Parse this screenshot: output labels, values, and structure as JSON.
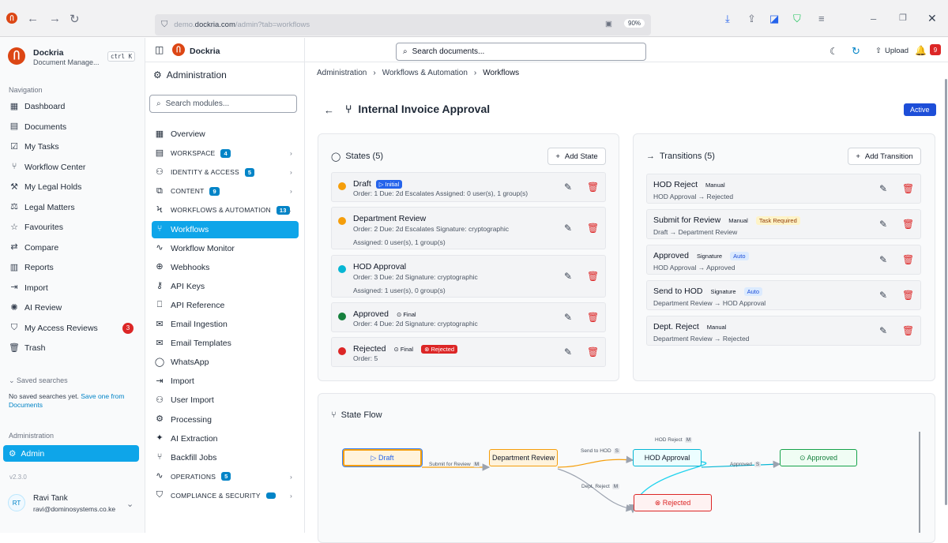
{
  "browser": {
    "url_prefix": "demo.",
    "url_domain": "dockria.com",
    "url_path": "/admin?tab=workflows",
    "zoom": "90%"
  },
  "app": {
    "name": "Dockria",
    "subtitle": "Document Manage...",
    "shortcut": "ctrl K"
  },
  "topbar": {
    "brand": "Dockria",
    "search_placeholder": "Search documents...",
    "upload_label": "Upload",
    "notif_count": "9"
  },
  "sidebar": {
    "nav_heading": "Navigation",
    "items": [
      {
        "label": "Dashboard",
        "icon": "dashboard-icon",
        "glyph": "▦"
      },
      {
        "label": "Documents",
        "icon": "document-icon",
        "glyph": "▤"
      },
      {
        "label": "My Tasks",
        "icon": "tasks-icon",
        "glyph": "☑"
      },
      {
        "label": "Workflow Center",
        "icon": "workflow-icon",
        "glyph": "⑂"
      },
      {
        "label": "My Legal Holds",
        "icon": "gavel-icon",
        "glyph": "⚒"
      },
      {
        "label": "Legal Matters",
        "icon": "scale-icon",
        "glyph": "⚖"
      },
      {
        "label": "Favourites",
        "icon": "star-icon",
        "glyph": "☆"
      },
      {
        "label": "Compare",
        "icon": "compare-icon",
        "glyph": "⇄"
      },
      {
        "label": "Reports",
        "icon": "chart-icon",
        "glyph": "▥"
      },
      {
        "label": "Import",
        "icon": "import-icon",
        "glyph": "⇥"
      },
      {
        "label": "AI Review",
        "icon": "ai-icon",
        "glyph": "✺"
      },
      {
        "label": "My Access Reviews",
        "icon": "shield-icon",
        "glyph": "⛉",
        "badge": "3"
      },
      {
        "label": "Trash",
        "icon": "trash-icon",
        "glyph": "🗑"
      }
    ],
    "saved_heading": "Saved searches",
    "saved_empty": "No saved searches yet.",
    "saved_link": "Save one from Documents",
    "admin_heading": "Administration",
    "admin_item": "Admin",
    "version": "v2.3.0",
    "user": {
      "initials": "RT",
      "name": "Ravi Tank",
      "email": "ravi@dominosystems.co.ke"
    }
  },
  "modules": {
    "title": "Administration",
    "search_placeholder": "Search modules...",
    "items": [
      {
        "label": "Overview",
        "glyph": "▦"
      },
      {
        "label": "Workspace",
        "glyph": "▤",
        "badge": "4",
        "group": true
      },
      {
        "label": "Identity & Access",
        "glyph": "⚇",
        "badge": "5",
        "group": true
      },
      {
        "label": "Content",
        "glyph": "⧉",
        "badge": "9",
        "group": true
      },
      {
        "label": "Workflows & Automation",
        "glyph": "ϟ",
        "badge": "13",
        "group": true,
        "open": true
      },
      {
        "label": "Workflows",
        "glyph": "⑂",
        "active": true
      },
      {
        "label": "Workflow Monitor",
        "glyph": "∿"
      },
      {
        "label": "Webhooks",
        "glyph": "⊕"
      },
      {
        "label": "API Keys",
        "glyph": "⚷"
      },
      {
        "label": "API Reference",
        "glyph": "⎕"
      },
      {
        "label": "Email Ingestion",
        "glyph": "✉"
      },
      {
        "label": "Email Templates",
        "glyph": "✉"
      },
      {
        "label": "WhatsApp",
        "glyph": "◯"
      },
      {
        "label": "Import",
        "glyph": "⇥"
      },
      {
        "label": "User Import",
        "glyph": "⚇"
      },
      {
        "label": "Processing",
        "glyph": "⚙"
      },
      {
        "label": "AI Extraction",
        "glyph": "✦"
      },
      {
        "label": "Backfill Jobs",
        "glyph": "⑂"
      },
      {
        "label": "Operations",
        "glyph": "∿",
        "badge": "5",
        "group": true
      },
      {
        "label": "Compliance & Security",
        "glyph": "⛉",
        "badge": "",
        "group": true
      }
    ]
  },
  "breadcrumb": [
    "Administration",
    "Workflows & Automation",
    "Workflows"
  ],
  "workflow": {
    "title": "Internal Invoice Approval",
    "status": "Active"
  },
  "states": {
    "heading": "States (5)",
    "add_label": "Add State",
    "rows": [
      {
        "name": "Draft",
        "color": "#f59e0b",
        "tag": "▷ Initial",
        "tagtype": "initial",
        "details": "Order: 1  Due: 2d  Escalates  Assigned: 0 user(s), 1 group(s)",
        "details2": ""
      },
      {
        "name": "Department Review",
        "color": "#f59e0b",
        "tag": "",
        "tagtype": "",
        "details": "Order: 2  Due: 2d  Escalates  Signature: cryptographic",
        "details2": "Assigned: 0 user(s), 1 group(s)"
      },
      {
        "name": "HOD Approval",
        "color": "#06b6d4",
        "tag": "",
        "tagtype": "",
        "details": "Order: 3  Due: 2d  Signature: cryptographic",
        "details2": "Assigned: 1 user(s), 0 group(s)"
      },
      {
        "name": "Approved",
        "color": "#15803d",
        "tag": "⊙ Final",
        "tagtype": "final",
        "details": "Order: 4  Due: 2d  Signature: cryptographic",
        "details2": ""
      },
      {
        "name": "Rejected",
        "color": "#dc2626",
        "tag": "⊙ Final",
        "tagtype": "final",
        "tag2": "⊗ Rejected",
        "details": "Order: 5",
        "details2": ""
      }
    ]
  },
  "transitions": {
    "heading": "Transitions (5)",
    "add_label": "Add Transition",
    "rows": [
      {
        "name": "HOD Reject",
        "tags": [
          "Manual"
        ],
        "route": "HOD Approval → Rejected"
      },
      {
        "name": "Submit for Review",
        "tags": [
          "Manual",
          "Task Required"
        ],
        "route": "Draft → Department Review"
      },
      {
        "name": "Approved",
        "tags": [
          "Signature",
          "Auto"
        ],
        "route": "HOD Approval → Approved"
      },
      {
        "name": "Send to HOD",
        "tags": [
          "Signature",
          "Auto"
        ],
        "route": "Department Review → HOD Approval"
      },
      {
        "name": "Dept. Reject",
        "tags": [
          "Manual"
        ],
        "route": "Department Review → Rejected"
      }
    ]
  },
  "flow": {
    "heading": "State Flow",
    "nodes": {
      "draft": "▷ Draft",
      "dept": "Department Review",
      "hod": "HOD Approval",
      "approved": "⊙ Approved",
      "rejected": "⊗ Rejected"
    },
    "edges": {
      "submit": "Submit for Review",
      "submit_k": "M",
      "send": "Send to HOD",
      "send_k": "S",
      "hod_reject": "HOD Reject",
      "hod_reject_k": "M",
      "approved": "Approved",
      "approved_k": "S",
      "dept_reject": "Dept. Reject",
      "dept_reject_k": "M"
    }
  },
  "colors": {
    "accent": "#0ea5e9",
    "brand": "#dc4614",
    "active_badge": "#1d4ed8"
  }
}
